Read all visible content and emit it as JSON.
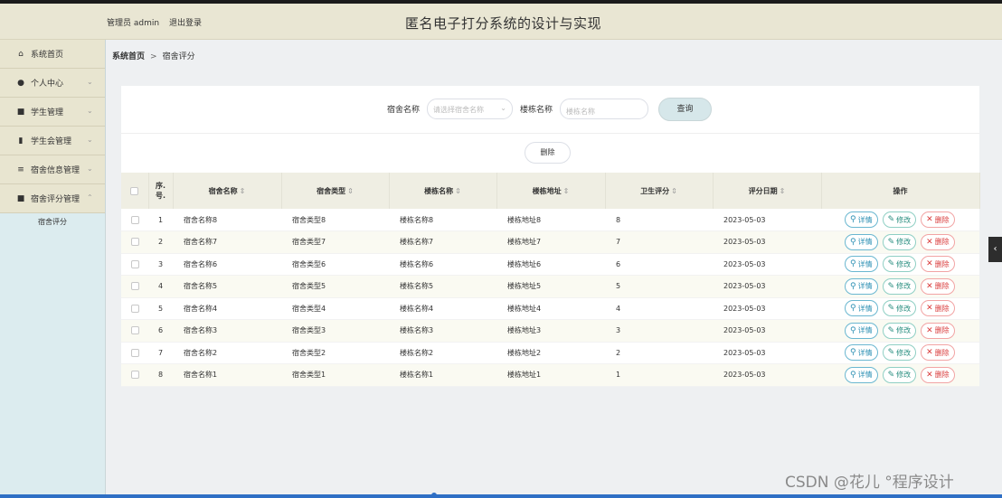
{
  "header": {
    "user_label": "管理员 admin",
    "logout": "退出登录",
    "title": "匿名电子打分系统的设计与实现"
  },
  "sidebar": {
    "items": [
      {
        "label": "系统首页",
        "icon": "home-icon",
        "glyph": "⌂",
        "chevron": ""
      },
      {
        "label": "个人中心",
        "icon": "user-icon",
        "glyph": "●",
        "chevron": "⌄"
      },
      {
        "label": "学生管理",
        "icon": "grid-icon",
        "glyph": "■",
        "chevron": "⌄"
      },
      {
        "label": "学生会管理",
        "icon": "clipboard-icon",
        "glyph": "▮",
        "chevron": "⌄"
      },
      {
        "label": "宿舍信息管理",
        "icon": "list-icon",
        "glyph": "≡",
        "chevron": "⌄"
      },
      {
        "label": "宿舍评分管理",
        "icon": "grid-icon",
        "glyph": "■",
        "chevron": "⌃"
      }
    ],
    "submenu": [
      "宿舍评分"
    ]
  },
  "breadcrumb": {
    "home": "系统首页",
    "separator": ">",
    "current": "宿舍评分"
  },
  "search": {
    "dorm_name_label": "宿舍名称",
    "dorm_name_placeholder": "请选择宿舍名称",
    "building_label": "楼栋名称",
    "building_placeholder": "楼栋名称",
    "query_button": "查询"
  },
  "toolbar": {
    "delete_button": "删除"
  },
  "table": {
    "columns": [
      "序号",
      "宿舍名称",
      "宿舍类型",
      "楼栋名称",
      "楼栋地址",
      "卫生评分",
      "评分日期",
      "操作"
    ],
    "index_header": "序.\n号.",
    "sort_glyph": "⇕",
    "rows": [
      {
        "idx": "1",
        "name": "宿舍名称8",
        "type": "宿舍类型8",
        "building": "楼栋名称8",
        "address": "楼栋地址8",
        "score": "8",
        "date": "2023-05-03"
      },
      {
        "idx": "2",
        "name": "宿舍名称7",
        "type": "宿舍类型7",
        "building": "楼栋名称7",
        "address": "楼栋地址7",
        "score": "7",
        "date": "2023-05-03"
      },
      {
        "idx": "3",
        "name": "宿舍名称6",
        "type": "宿舍类型6",
        "building": "楼栋名称6",
        "address": "楼栋地址6",
        "score": "6",
        "date": "2023-05-03"
      },
      {
        "idx": "4",
        "name": "宿舍名称5",
        "type": "宿舍类型5",
        "building": "楼栋名称5",
        "address": "楼栋地址5",
        "score": "5",
        "date": "2023-05-03"
      },
      {
        "idx": "5",
        "name": "宿舍名称4",
        "type": "宿舍类型4",
        "building": "楼栋名称4",
        "address": "楼栋地址4",
        "score": "4",
        "date": "2023-05-03"
      },
      {
        "idx": "6",
        "name": "宿舍名称3",
        "type": "宿舍类型3",
        "building": "楼栋名称3",
        "address": "楼栋地址3",
        "score": "3",
        "date": "2023-05-03"
      },
      {
        "idx": "7",
        "name": "宿舍名称2",
        "type": "宿舍类型2",
        "building": "楼栋名称2",
        "address": "楼栋地址2",
        "score": "2",
        "date": "2023-05-03"
      },
      {
        "idx": "8",
        "name": "宿舍名称1",
        "type": "宿舍类型1",
        "building": "楼栋名称1",
        "address": "楼栋地址1",
        "score": "1",
        "date": "2023-05-03"
      }
    ],
    "actions": {
      "detail": "详情",
      "edit": "修改",
      "delete": "删除"
    }
  },
  "watermark": "CSDN @花儿 °程序设计"
}
